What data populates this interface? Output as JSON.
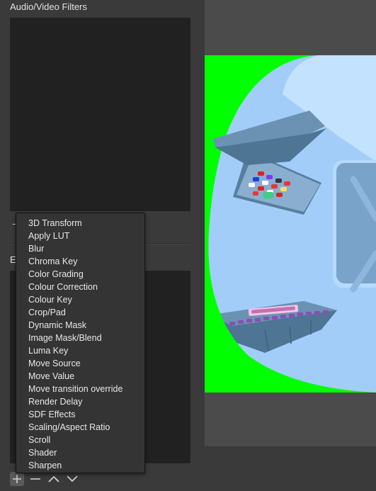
{
  "left_panel": {
    "av_filters_label": "Audio/Video Filters",
    "av_toolbar": {
      "remove_glyph": "−"
    },
    "effect_filters_label_visible": "E",
    "effect_toolbar": {
      "add_icon": "plus-icon",
      "remove_icon": "minus-icon",
      "up_icon": "chevron-up-icon",
      "down_icon": "chevron-down-icon"
    }
  },
  "add_filter_menu": {
    "items": [
      "3D Transform",
      "Apply LUT",
      "Blur",
      "Chroma Key",
      "Color Grading",
      "Colour Correction",
      "Colour Key",
      "Crop/Pad",
      "Dynamic Mask",
      "Image Mask/Blend",
      "Luma Key",
      "Move Source",
      "Move Value",
      "Move transition override",
      "Render Delay",
      "SDF Effects",
      "Scaling/Aspect Ratio",
      "Scroll",
      "Shader",
      "Sharpen"
    ]
  },
  "preview": {
    "background_key_color": "#00ff00",
    "scene_colors": {
      "wall_light": "#c3e2fd",
      "wall_mid": "#a2cdf8",
      "panel": "#7aa3c9",
      "console": "#5e88a8"
    }
  }
}
